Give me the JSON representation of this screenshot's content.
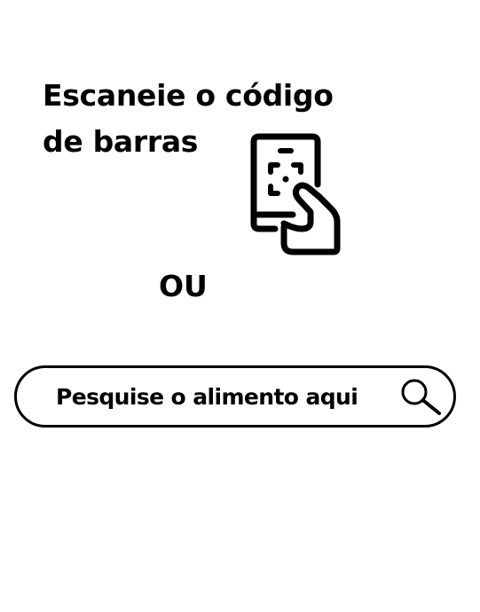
{
  "title": {
    "line1": "Escaneie o código",
    "line2": "de barras"
  },
  "scan": {
    "icon": "barcode-scan-phone-icon"
  },
  "separator": {
    "label": "OU"
  },
  "search": {
    "placeholder": "Pesquise o alimento aqui...",
    "icon": "search-icon"
  },
  "colors": {
    "text": "#000000",
    "background": "#ffffff",
    "border": "#000000"
  }
}
